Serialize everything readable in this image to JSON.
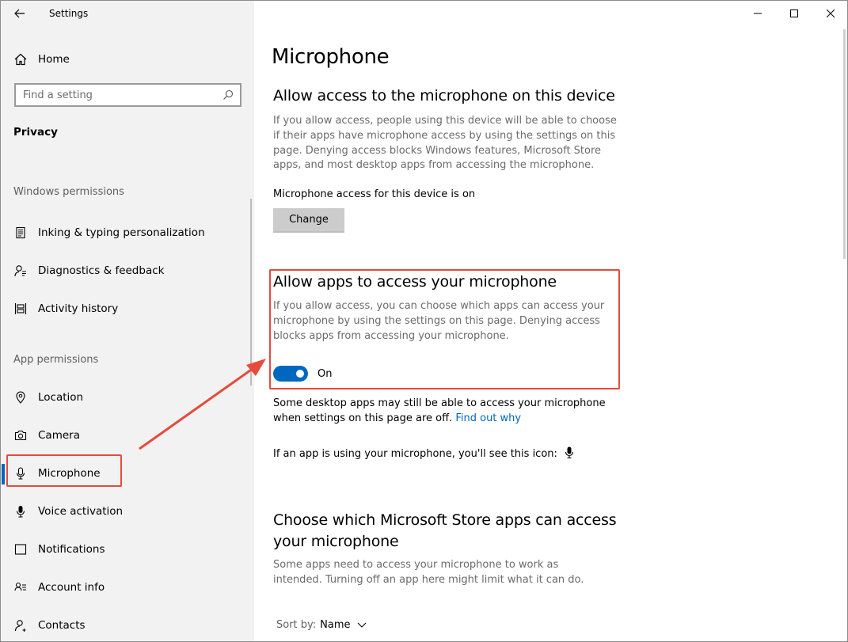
{
  "app": {
    "title": "Settings"
  },
  "sidebar": {
    "home_label": "Home",
    "search_placeholder": "Find a setting",
    "section_title": "Privacy",
    "groups": {
      "windows_permissions": "Windows permissions",
      "app_permissions": "App permissions"
    },
    "windows_items": [
      {
        "label": "Inking & typing personalization",
        "icon": "inking-icon"
      },
      {
        "label": "Diagnostics & feedback",
        "icon": "diagnostics-icon"
      },
      {
        "label": "Activity history",
        "icon": "activity-history-icon"
      }
    ],
    "app_items": [
      {
        "label": "Location",
        "icon": "location-icon"
      },
      {
        "label": "Camera",
        "icon": "camera-icon"
      },
      {
        "label": "Microphone",
        "icon": "microphone-icon",
        "selected": true
      },
      {
        "label": "Voice activation",
        "icon": "voice-activation-icon"
      },
      {
        "label": "Notifications",
        "icon": "notifications-icon"
      },
      {
        "label": "Account info",
        "icon": "account-info-icon"
      },
      {
        "label": "Contacts",
        "icon": "contacts-icon"
      }
    ]
  },
  "main": {
    "page_title": "Microphone",
    "device_section": {
      "heading": "Allow access to the microphone on this device",
      "description": "If you allow access, people using this device will be able to choose if their apps have microphone access by using the settings on this page. Denying access blocks Windows features, Microsoft Store apps, and most desktop apps from accessing the microphone.",
      "status": "Microphone access for this device is on",
      "change_button": "Change"
    },
    "apps_section": {
      "heading": "Allow apps to access your microphone",
      "description": "If you allow access, you can choose which apps can access your microphone by using the settings on this page. Denying access blocks apps from accessing your microphone.",
      "toggle_state": "On",
      "toggle_on": true
    },
    "desktop_note": {
      "text": "Some desktop apps may still be able to access your microphone when settings on this page are off.",
      "link": "Find out why"
    },
    "icon_note": "If an app is using your microphone, you'll see this icon:",
    "store_section": {
      "heading_line1": "Choose which Microsoft Store apps can access",
      "heading_line2": "your microphone",
      "description": "Some apps need to access your microphone to work as intended. Turning off an app here might limit what it can do."
    },
    "sort": {
      "label": "Sort by:",
      "value": "Name"
    }
  },
  "colors": {
    "accent": "#0067c0",
    "annotation_red": "#e64b3c",
    "sidebar_bg": "#f2f2f2"
  }
}
